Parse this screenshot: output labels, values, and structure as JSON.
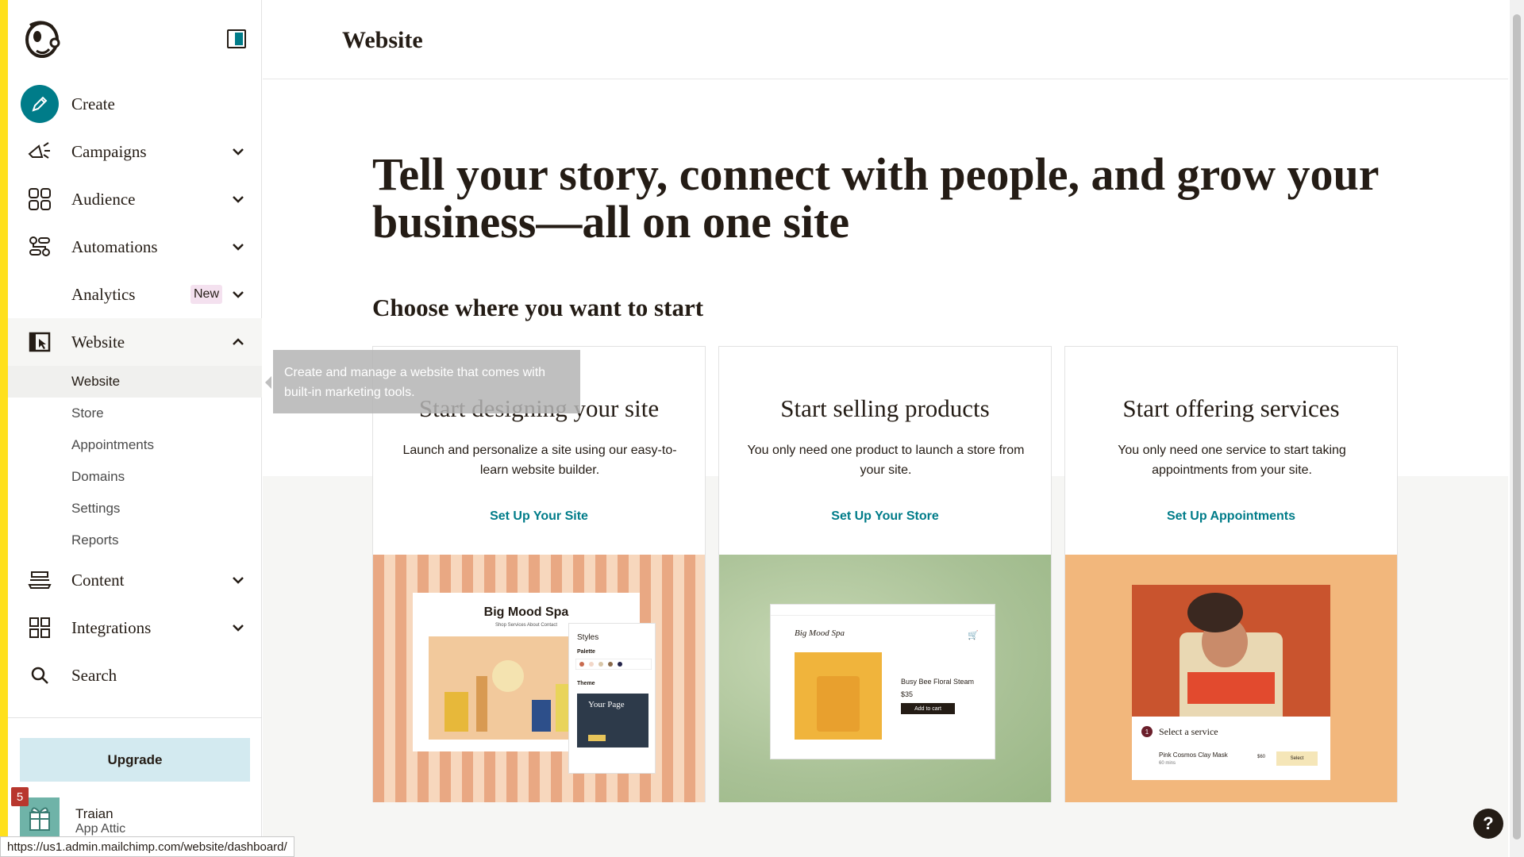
{
  "sidebar": {
    "nav": [
      {
        "label": "Create"
      },
      {
        "label": "Campaigns"
      },
      {
        "label": "Audience"
      },
      {
        "label": "Automations"
      },
      {
        "label": "Analytics",
        "badge": "New"
      },
      {
        "label": "Website"
      },
      {
        "label": "Content"
      },
      {
        "label": "Integrations"
      },
      {
        "label": "Search"
      }
    ],
    "website_sub": [
      "Website",
      "Store",
      "Appointments",
      "Domains",
      "Settings",
      "Reports"
    ],
    "upgrade_label": "Upgrade",
    "user": {
      "name": "Traian",
      "org": "App Attic",
      "notifications": "5"
    }
  },
  "header": {
    "title": "Website"
  },
  "hero": {
    "headline": "Tell your story, connect with people, and grow your business—all on one site",
    "subheading": "Choose where you want to start"
  },
  "tooltip": "Create and manage a website that comes with built-in marketing tools.",
  "cards": [
    {
      "title": "Start designing your site",
      "description": "Launch and personalize a site using our easy-to-learn website builder.",
      "link": "Set Up Your Site",
      "mock": {
        "brand": "Big Mood Spa",
        "nav": "Shop   Services   About   Contact",
        "styles": "Styles",
        "palette": "Palette",
        "theme": "Theme",
        "page": "Your Page",
        "swatches": [
          "#c86b4f",
          "#f2d7c8",
          "#d8c6a8",
          "#8a6a4a",
          "#24244a"
        ]
      }
    },
    {
      "title": "Start selling products",
      "description": "You only need one product to launch a store from your site.",
      "link": "Set Up Your Store",
      "mock": {
        "brand": "Big Mood Spa",
        "product": "Busy Bee Floral Steam",
        "price": "$35",
        "cta": "Add to cart"
      }
    },
    {
      "title": "Start offering services",
      "description": "You only need one service to start taking appointments from your site.",
      "link": "Set Up Appointments",
      "mock": {
        "step": "1",
        "heading": "Select a service",
        "service": "Pink Cosmos Clay Mask",
        "duration": "60 mins",
        "price": "$60",
        "cta": "Select"
      }
    }
  ],
  "status_url": "https://us1.admin.mailchimp.com/website/dashboard/",
  "help_label": "?",
  "colors": {
    "accent": "#007c89",
    "brand_yellow": "#ffe01b",
    "upgrade_bg": "#d3eaf0",
    "text": "#241c15"
  }
}
